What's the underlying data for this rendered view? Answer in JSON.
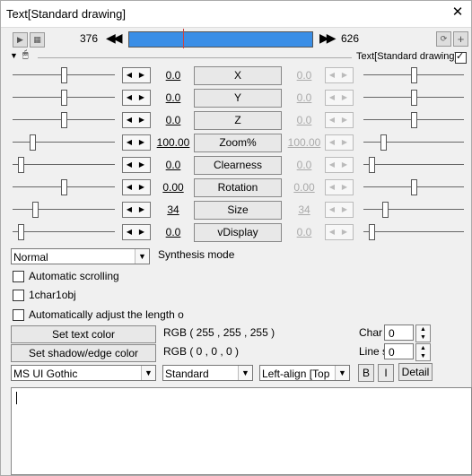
{
  "window": {
    "title": "Text[Standard drawing]",
    "close": "✕"
  },
  "toolbar": {
    "frame_start": "376",
    "frame_end": "626",
    "object_name": "Text[Standard drawing]"
  },
  "params": [
    {
      "name": "X",
      "left_value": "0.0",
      "right_value": "0.0",
      "left_frac": 0.5,
      "right_frac": 0.5
    },
    {
      "name": "Y",
      "left_value": "0.0",
      "right_value": "0.0",
      "left_frac": 0.5,
      "right_frac": 0.5
    },
    {
      "name": "Z",
      "left_value": "0.0",
      "right_value": "0.0",
      "left_frac": 0.5,
      "right_frac": 0.5
    },
    {
      "name": "Zoom%",
      "left_value": "100.00",
      "right_value": "100.00",
      "left_frac": 0.18,
      "right_frac": 0.18
    },
    {
      "name": "Clearness",
      "left_value": "0.0",
      "right_value": "0.0",
      "left_frac": 0.06,
      "right_frac": 0.06
    },
    {
      "name": "Rotation",
      "left_value": "0.00",
      "right_value": "0.00",
      "left_frac": 0.5,
      "right_frac": 0.5
    },
    {
      "name": "Size",
      "left_value": "34",
      "right_value": "34",
      "left_frac": 0.2,
      "right_frac": 0.2
    },
    {
      "name": "vDisplay",
      "left_value": "0.0",
      "right_value": "0.0",
      "left_frac": 0.06,
      "right_frac": 0.06
    }
  ],
  "blend": {
    "value": "Normal",
    "label": "Synthesis mode"
  },
  "options": {
    "auto_scroll": "Automatic scrolling",
    "char_obj": "1char1obj",
    "auto_adjust": "Automatically adjust the length o"
  },
  "color": {
    "text_button": "Set text color",
    "text_value": "RGB ( 255 , 255 , 255 )",
    "shadow_button": "Set shadow/edge color",
    "shadow_value": "RGB ( 0 , 0 , 0 )"
  },
  "spacing": {
    "char_label": "Char",
    "char_value": "0",
    "line_label": "Line s",
    "line_value": "0"
  },
  "font": {
    "family": "MS UI Gothic",
    "style": "Standard",
    "align": "Left-align [Top"
  },
  "format": {
    "bold": "B",
    "italic": "I",
    "detail": "Detail"
  },
  "text_content": ""
}
